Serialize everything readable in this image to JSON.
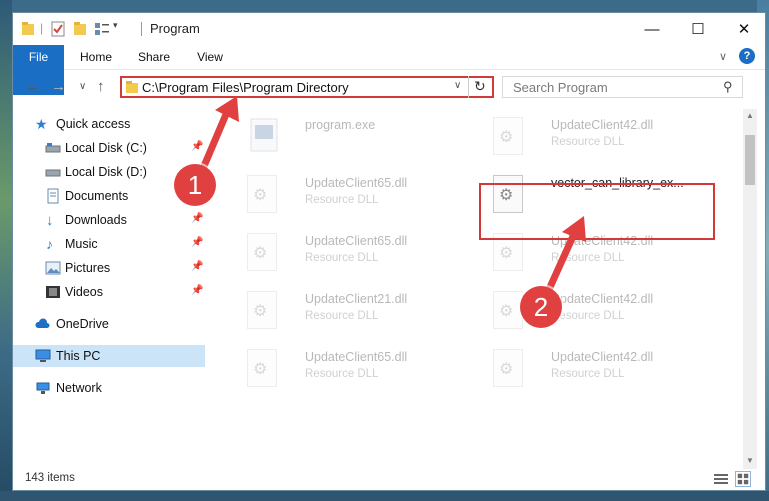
{
  "window": {
    "title": "Program",
    "controls": {
      "minimize": "—",
      "maximize": "☐",
      "close": "✕"
    }
  },
  "ribbon": {
    "tabs": [
      {
        "label": "File"
      },
      {
        "label": "Home"
      },
      {
        "label": "Share"
      },
      {
        "label": "View"
      }
    ],
    "help": "?"
  },
  "address": {
    "path": "C:\\Program Files\\Program Directory",
    "search_placeholder": "Search Program"
  },
  "sidebar": {
    "items": [
      {
        "label": "Quick access",
        "icon": "star-icon"
      },
      {
        "label": "Local Disk (C:)",
        "icon": "drive-icon",
        "pinned": true
      },
      {
        "label": "Local Disk (D:)",
        "icon": "drive-icon"
      },
      {
        "label": "Documents",
        "icon": "documents-icon",
        "pinned": true
      },
      {
        "label": "Downloads",
        "icon": "download-icon",
        "pinned": true
      },
      {
        "label": "Music",
        "icon": "music-icon",
        "pinned": true
      },
      {
        "label": "Pictures",
        "icon": "pictures-icon",
        "pinned": true
      },
      {
        "label": "Videos",
        "icon": "videos-icon",
        "pinned": true
      },
      {
        "label": "OneDrive",
        "icon": "cloud-icon"
      },
      {
        "label": "This PC",
        "icon": "computer-icon",
        "selected": true
      },
      {
        "label": "Network",
        "icon": "network-icon"
      }
    ]
  },
  "files": [
    {
      "name": "program.exe",
      "type": ""
    },
    {
      "name": "UpdateClient42.dll",
      "type": "Resource DLL"
    },
    {
      "name": "UpdateClient65.dll",
      "type": "Resource DLL"
    },
    {
      "name": "vector_can_library_ex...",
      "type": ""
    },
    {
      "name": "UpdateClient65.dll",
      "type": "Resource DLL"
    },
    {
      "name": "UpdateClient42.dll",
      "type": "Resource DLL"
    },
    {
      "name": "UpdateClient21.dll",
      "type": "Resource DLL"
    },
    {
      "name": "UpdateClient42.dll",
      "type": "Resource DLL"
    },
    {
      "name": "UpdateClient65.dll",
      "type": "Resource DLL"
    },
    {
      "name": "UpdateClient42.dll",
      "type": "Resource DLL"
    }
  ],
  "status": {
    "items_count": "143 items"
  },
  "annotations": {
    "step1": "1",
    "step2": "2",
    "color": "#e04040"
  }
}
